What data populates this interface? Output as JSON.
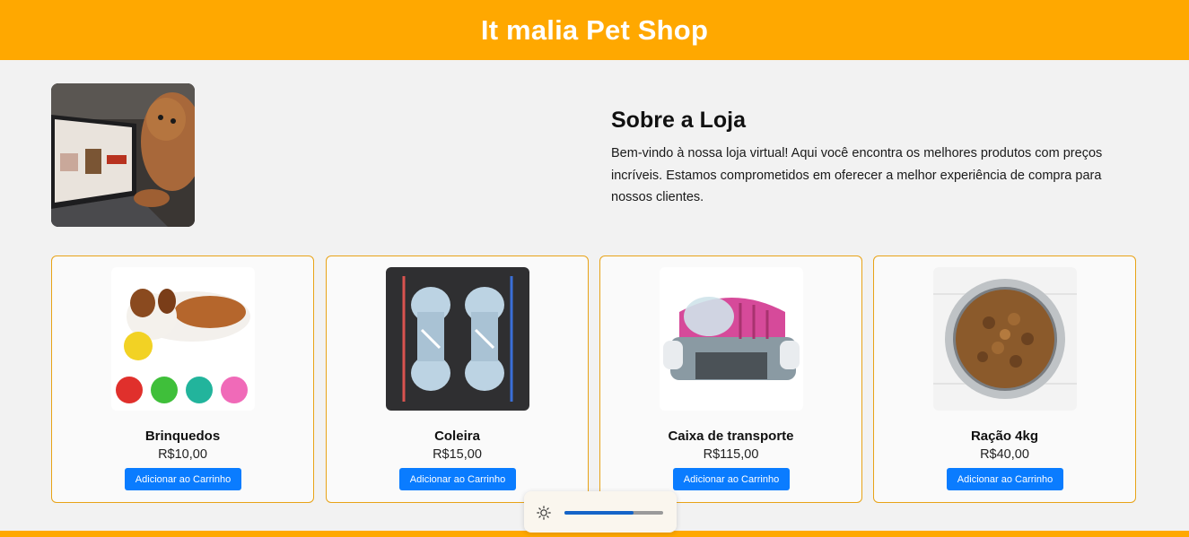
{
  "header": {
    "title": "It malia Pet Shop"
  },
  "about": {
    "title": "Sobre a Loja",
    "text": "Bem-vindo à nossa loja virtual! Aqui você encontra os melhores produtos com preços incríveis. Estamos comprometidos em oferecer a melhor experiência de compra para nossos clientes."
  },
  "products": [
    {
      "name": "Brinquedos",
      "price": "R$10,00",
      "button": "Adicionar ao Carrinho"
    },
    {
      "name": "Coleira",
      "price": "R$15,00",
      "button": "Adicionar ao Carrinho"
    },
    {
      "name": "Caixa de transporte",
      "price": "R$115,00",
      "button": "Adicionar ao Carrinho"
    },
    {
      "name": "Ração 4kg",
      "price": "R$40,00",
      "button": "Adicionar ao Carrinho"
    }
  ],
  "brightness": {
    "icon": "sun-icon",
    "level": 0.7
  },
  "colors": {
    "brand": "#ffa800",
    "button": "#0a7cff",
    "card_border": "#e8a317"
  }
}
